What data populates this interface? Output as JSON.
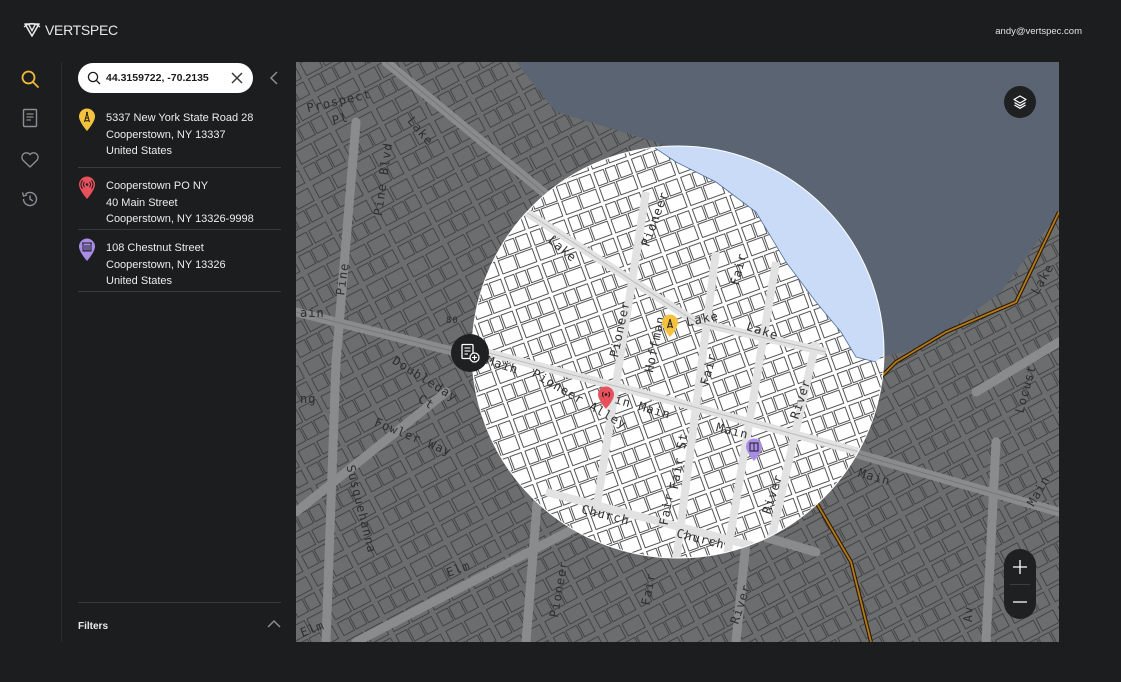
{
  "app": {
    "brand": "VERTSPEC",
    "user_email": "andy@vertspec.com"
  },
  "rail": [
    {
      "name": "search-icon",
      "active": true
    },
    {
      "name": "document-icon",
      "active": false
    },
    {
      "name": "heart-icon",
      "active": false
    },
    {
      "name": "history-icon",
      "active": false
    }
  ],
  "search": {
    "value": "44.3159722, -70.2135",
    "placeholder": ""
  },
  "results": [
    {
      "type": "tower",
      "pin_color": "#f5c23e",
      "icon": "cell-tower-icon",
      "lines": [
        "5337 New York State Road 28",
        "Cooperstown, NY 13337",
        "United States"
      ]
    },
    {
      "type": "signal",
      "pin_color": "#e8505b",
      "icon": "broadcast-icon",
      "lines": [
        "Cooperstown PO NY",
        "40 Main Street",
        "Cooperstown, NY 13326-9998"
      ]
    },
    {
      "type": "building",
      "pin_color": "#a98ce6",
      "icon": "building-icon",
      "lines": [
        "108 Chestnut Street",
        "Cooperstown, NY 13326",
        "United States"
      ]
    }
  ],
  "filters": {
    "label": "Filters"
  },
  "map": {
    "street_labels": {
      "prospect": "Prospect",
      "pl": "Pl",
      "lake_nw": "Lake",
      "pine_blvd": "Pine Blvd",
      "pine": "Pine",
      "ain": "ain",
      "doubleday": "Doubleday",
      "ct": "Ct",
      "fowler_way": "Fowler Way",
      "ng": "ng",
      "susquehanna": "Susquehanna",
      "elm": "Elm",
      "elm_sw": "Elm",
      "lake_center": "Lake",
      "pioneer_n": "Pioneer",
      "pioneer_mid": "Pioneer",
      "hoffman": "Hoffman",
      "lake_e": "Lake",
      "lake_e2": "Lake",
      "fair_n": "Fair",
      "fair_mid": "Fair",
      "main_w": "Main",
      "pioneer_alley": "Pioneer Alley",
      "main_c": "in Main",
      "main_e": "Main",
      "fair_st": "Fair St",
      "fair_s": "Fair",
      "river_n": "River",
      "river_s": "River",
      "church_w": "Church",
      "church_e": "Church",
      "fair_bottom": "Fair",
      "pioneer_s": "Pioneer",
      "river_bottom": "River",
      "main_far_e": "Main",
      "main_far_e2": "Main",
      "locust": "Locust",
      "av": "Av",
      "lake_far_e": "Lake",
      "num_80": "80"
    },
    "colors": {
      "water": "#c9dbf7",
      "land": "#ffffff",
      "dim_overlay": "#6b6c6e",
      "boundary": "#b37a1a"
    },
    "markers": [
      {
        "type": "tower",
        "color": "#f5c23e"
      },
      {
        "type": "signal",
        "color": "#e8505b"
      },
      {
        "type": "building",
        "color": "#a98ce6"
      }
    ]
  },
  "controls": {
    "layers_icon": "layers-icon",
    "zoom_in_icon": "plus-icon",
    "zoom_out_icon": "minus-icon",
    "report_icon": "add-report-icon",
    "collapse_icon": "chevron-left-icon",
    "filters_icon": "chevron-up-icon"
  }
}
